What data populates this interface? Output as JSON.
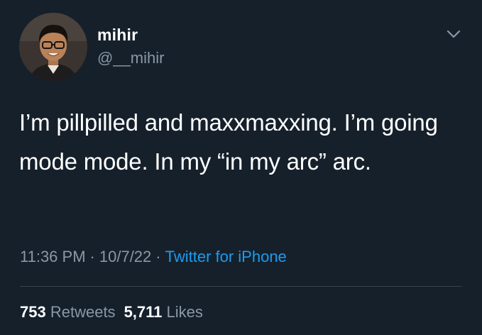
{
  "user": {
    "display_name": "mihir",
    "handle": "@__mihir"
  },
  "tweet": {
    "text": "I’m pillpilled and maxxmaxxing. I’m going mode mode. In my “in my arc” arc.",
    "time": "11:36 PM",
    "date": "10/7/22",
    "separator": "·",
    "source": "Twitter for iPhone"
  },
  "stats": {
    "retweets_count": "753",
    "retweets_label": "Retweets",
    "likes_count": "5,711",
    "likes_label": "Likes"
  },
  "icons": {
    "menu": "chevron-down-icon"
  },
  "colors": {
    "background": "#15202b",
    "secondary_text": "#8b98a5",
    "link": "#1d9bf0",
    "divider": "#38444d"
  }
}
